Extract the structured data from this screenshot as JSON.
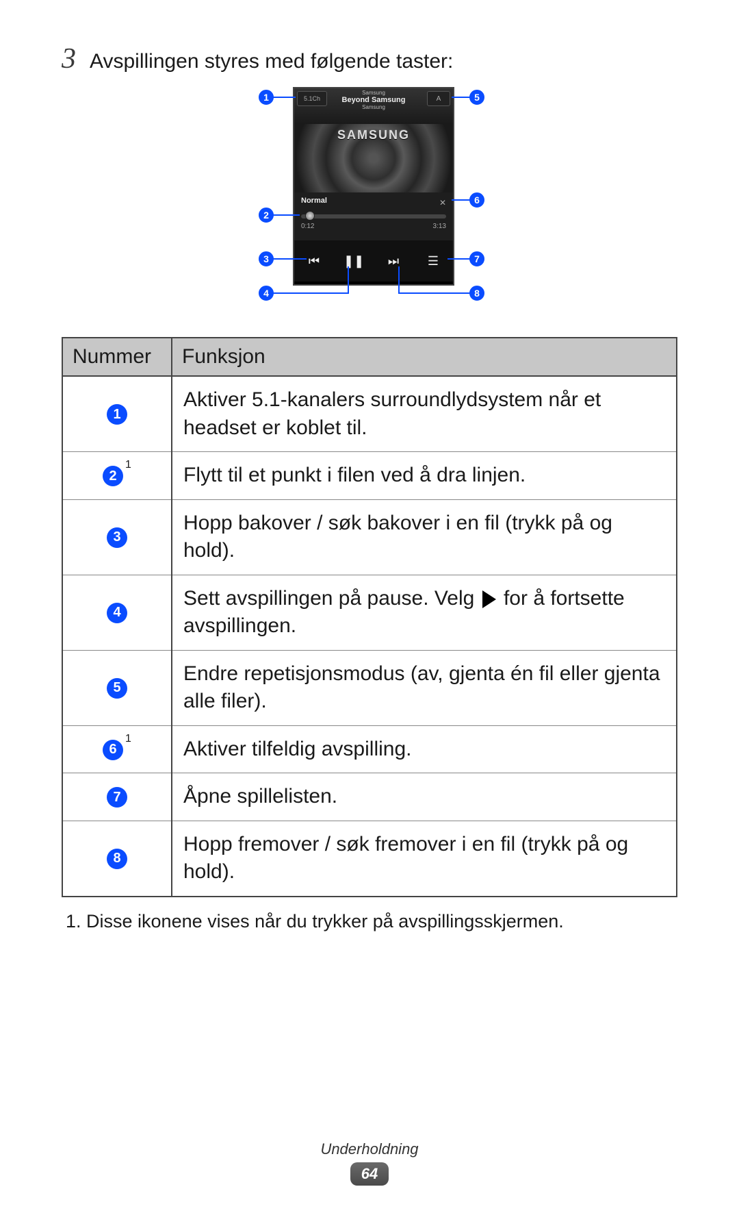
{
  "step": {
    "num": "3",
    "text": "Avspillingen styres med følgende taster:"
  },
  "player": {
    "btn51": "5.1Ch",
    "btnA": "A",
    "artist": "Samsung",
    "title": "Beyond Samsung",
    "album": "Samsung",
    "logo": "SAMSUNG",
    "eq": "Normal",
    "elapsed": "0:12",
    "total": "3:13",
    "shuffle_glyph": "✕",
    "prev_glyph": "⏮",
    "pause_glyph": "❚❚",
    "next_glyph": "⏭",
    "list_glyph": "☰"
  },
  "callouts": {
    "c1": "1",
    "c2": "2",
    "c3": "3",
    "c4": "4",
    "c5": "5",
    "c6": "6",
    "c7": "7",
    "c8": "8"
  },
  "table": {
    "headers": {
      "num": "Nummer",
      "func": "Funksjon"
    },
    "rows": [
      {
        "badge": "1",
        "sup": "",
        "func": "Aktiver 5.1-kanalers surroundlydsystem når et headset er koblet til."
      },
      {
        "badge": "2",
        "sup": "1",
        "func": "Flytt til et punkt i filen ved å dra linjen."
      },
      {
        "badge": "3",
        "sup": "",
        "func": "Hopp bakover / søk bakover i en fil (trykk på og hold)."
      },
      {
        "badge": "4",
        "sup": "",
        "func_pre": "Sett avspillingen på pause. Velg ",
        "func_post": " for å fortsette avspillingen."
      },
      {
        "badge": "5",
        "sup": "",
        "func": "Endre repetisjonsmodus (av, gjenta én fil eller gjenta alle filer)."
      },
      {
        "badge": "6",
        "sup": "1",
        "func": "Aktiver tilfeldig avspilling."
      },
      {
        "badge": "7",
        "sup": "",
        "func": "Åpne spillelisten."
      },
      {
        "badge": "8",
        "sup": "",
        "func": "Hopp fremover / søk fremover i en fil (trykk på og hold)."
      }
    ]
  },
  "footnote": "1.  Disse ikonene vises når du trykker på avspillingsskjermen.",
  "footer": {
    "category": "Underholdning",
    "page": "64"
  }
}
